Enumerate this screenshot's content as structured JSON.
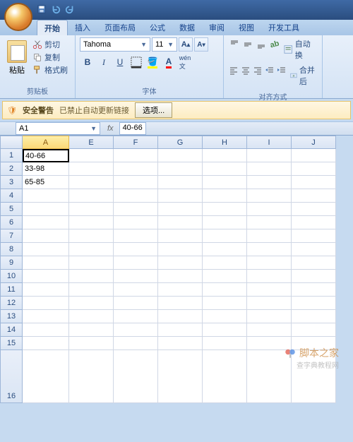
{
  "window": {
    "app": "Microsoft Excel"
  },
  "tabs": [
    "开始",
    "插入",
    "页面布局",
    "公式",
    "数据",
    "审阅",
    "视图",
    "开发工具"
  ],
  "active_tab": 0,
  "clipboard": {
    "paste": "粘贴",
    "cut": "剪切",
    "copy": "复制",
    "format_painter": "格式刷",
    "group_label": "剪贴板"
  },
  "font": {
    "name": "Tahoma",
    "size": "11",
    "group_label": "字体"
  },
  "align": {
    "wrap": "自动换",
    "merge": "合并后",
    "group_label": "对齐方式"
  },
  "security": {
    "title": "安全警告",
    "message": "已禁止自动更新链接",
    "button": "选项..."
  },
  "namebox": "A1",
  "formula": "40-66",
  "columns": [
    "A",
    "E",
    "F",
    "G",
    "H",
    "I",
    "J"
  ],
  "rows": [
    "1",
    "2",
    "3",
    "4",
    "5",
    "6",
    "7",
    "8",
    "9",
    "10",
    "11",
    "12",
    "13",
    "14",
    "15",
    "16"
  ],
  "cells": {
    "A1": "40-66",
    "A2": "33-98",
    "A3": "65-85"
  },
  "active_cell": "A1",
  "watermark": {
    "main": "脚本之家",
    "sub": "查字典教程网"
  }
}
